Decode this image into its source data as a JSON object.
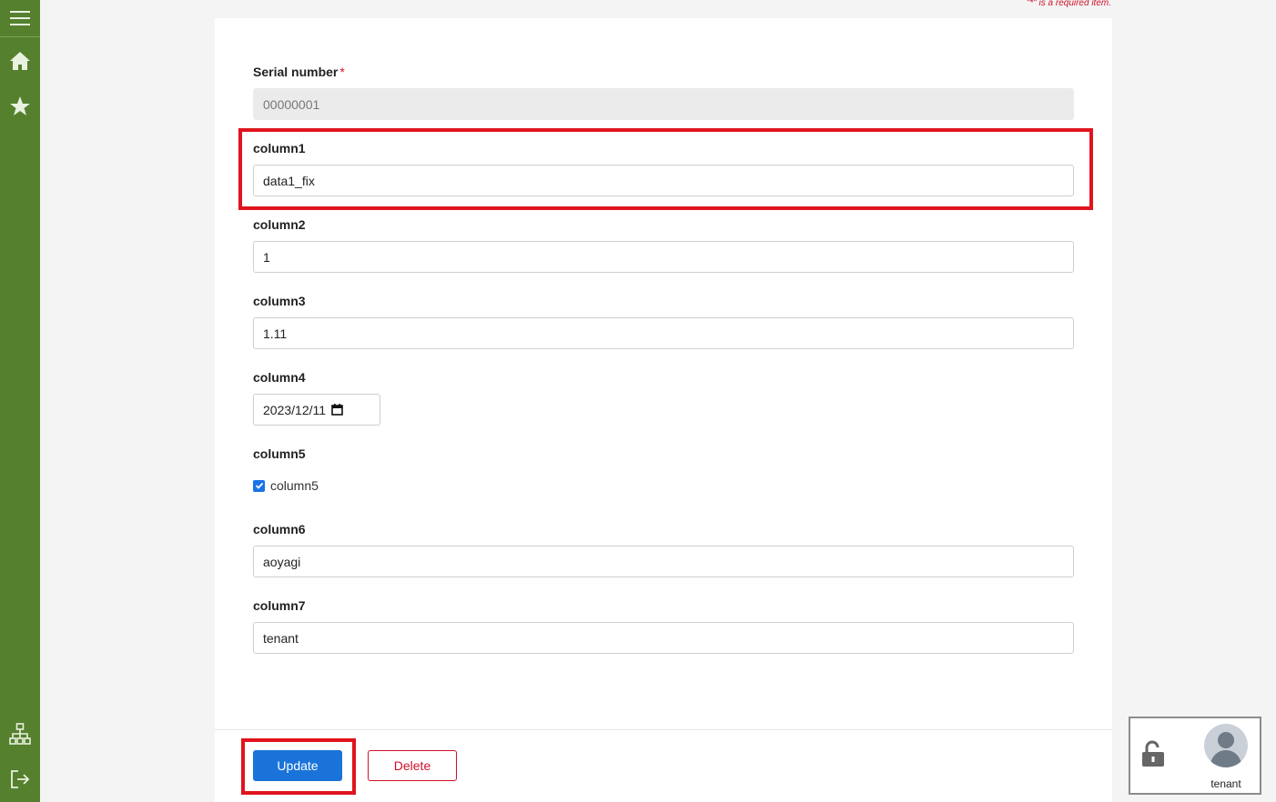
{
  "sidebar": {
    "items": [
      {
        "name": "menu-icon"
      },
      {
        "name": "home-icon"
      },
      {
        "name": "star-icon"
      },
      {
        "name": "sitemap-icon"
      },
      {
        "name": "logout-icon"
      }
    ],
    "color": "#55802d"
  },
  "required_note": "\"*\" is a required item.",
  "form": {
    "serial": {
      "label": "Serial number",
      "required_mark": "*",
      "value": "00000001"
    },
    "column1": {
      "label": "column1",
      "value": "data1_fix"
    },
    "column2": {
      "label": "column2",
      "value": "1"
    },
    "column3": {
      "label": "column3",
      "value": "1.11"
    },
    "column4": {
      "label": "column4",
      "value": "2023/12/11"
    },
    "column5": {
      "label": "column5",
      "checkbox_label": "column5",
      "checked": true
    },
    "column6": {
      "label": "column6",
      "value": "aoyagi"
    },
    "column7": {
      "label": "column7",
      "value": "tenant"
    }
  },
  "actions": {
    "update_label": "Update",
    "delete_label": "Delete"
  },
  "user": {
    "name": "tenant"
  },
  "colors": {
    "primary": "#1a73d9",
    "danger": "#d0112b",
    "highlight": "#e0141e"
  }
}
